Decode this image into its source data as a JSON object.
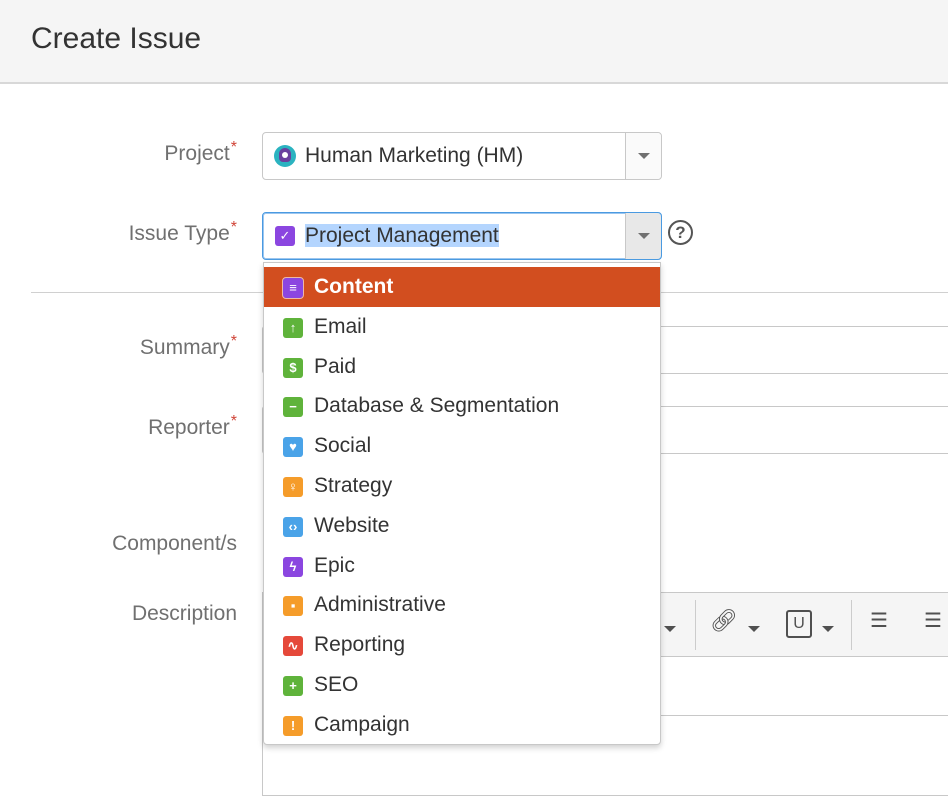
{
  "dialog": {
    "title": "Create Issue"
  },
  "form": {
    "project": {
      "label": "Project",
      "required_mark": "*",
      "value": "Human Marketing (HM)"
    },
    "issue_type": {
      "label": "Issue Type",
      "required_mark": "*",
      "value": "Project Management",
      "help": "?"
    },
    "summary": {
      "label": "Summary",
      "required_mark": "*"
    },
    "reporter": {
      "label": "Reporter",
      "required_mark": "*"
    },
    "components": {
      "label": "Component/s"
    },
    "description": {
      "label": "Description"
    }
  },
  "issue_type_options": [
    {
      "label": "Content",
      "icon": "content-icon",
      "color": "#8b46e0",
      "glyph": "≡",
      "active": true
    },
    {
      "label": "Email",
      "icon": "email-icon",
      "color": "#5fb33b",
      "glyph": "↑"
    },
    {
      "label": "Paid",
      "icon": "paid-icon",
      "color": "#5fb33b",
      "glyph": "$"
    },
    {
      "label": "Database & Segmentation",
      "icon": "database-icon",
      "color": "#5fb33b",
      "glyph": "−"
    },
    {
      "label": "Social",
      "icon": "social-icon",
      "color": "#4aa3e8",
      "glyph": "♥"
    },
    {
      "label": "Strategy",
      "icon": "strategy-icon",
      "color": "#f59c2a",
      "glyph": "♀"
    },
    {
      "label": "Website",
      "icon": "website-icon",
      "color": "#4aa3e8",
      "glyph": "‹›"
    },
    {
      "label": "Epic",
      "icon": "epic-icon",
      "color": "#8b46e0",
      "glyph": "ϟ"
    },
    {
      "label": "Administrative",
      "icon": "administrative-icon",
      "color": "#f59c2a",
      "glyph": "▪"
    },
    {
      "label": "Reporting",
      "icon": "reporting-icon",
      "color": "#e5493a",
      "glyph": "∿"
    },
    {
      "label": "SEO",
      "icon": "seo-icon",
      "color": "#5fb33b",
      "glyph": "+"
    },
    {
      "label": "Campaign",
      "icon": "campaign-icon",
      "color": "#f59c2a",
      "glyph": "!"
    }
  ],
  "colors": {
    "accent_active": "#d24e1f",
    "required": "#d04437",
    "selection": "#b4d5fe"
  }
}
